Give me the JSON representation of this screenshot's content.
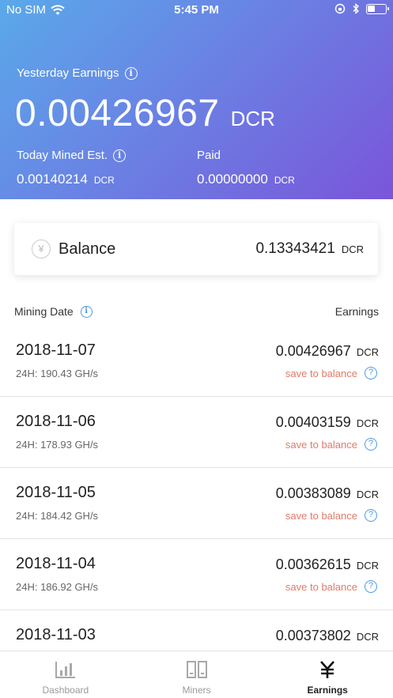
{
  "status": {
    "carrier": "No SIM",
    "time": "5:45 PM"
  },
  "hero": {
    "yesterday_label": "Yesterday Earnings",
    "yesterday_value": "0.00426967",
    "yesterday_unit": "DCR",
    "today_label": "Today Mined Est.",
    "today_value": "0.00140214",
    "today_unit": "DCR",
    "paid_label": "Paid",
    "paid_value": "0.00000000",
    "paid_unit": "DCR"
  },
  "balance": {
    "label": "Balance",
    "value": "0.13343421",
    "unit": "DCR"
  },
  "list": {
    "col_date": "Mining Date",
    "col_earnings": "Earnings",
    "rows": [
      {
        "date": "2018-11-07",
        "hashrate": "24H: 190.43 GH/s",
        "amount": "0.00426967",
        "unit": "DCR",
        "action": "save to balance"
      },
      {
        "date": "2018-11-06",
        "hashrate": "24H: 178.93 GH/s",
        "amount": "0.00403159",
        "unit": "DCR",
        "action": "save to balance"
      },
      {
        "date": "2018-11-05",
        "hashrate": "24H: 184.42 GH/s",
        "amount": "0.00383089",
        "unit": "DCR",
        "action": "save to balance"
      },
      {
        "date": "2018-11-04",
        "hashrate": "24H: 186.92 GH/s",
        "amount": "0.00362615",
        "unit": "DCR",
        "action": "save to balance"
      },
      {
        "date": "2018-11-03",
        "hashrate": "",
        "amount": "0.00373802",
        "unit": "DCR",
        "action": ""
      }
    ]
  },
  "tabs": [
    {
      "label": "Dashboard",
      "icon": "bar-chart-icon",
      "active": false
    },
    {
      "label": "Miners",
      "icon": "miners-icon",
      "active": false
    },
    {
      "label": "Earnings",
      "icon": "yen-icon",
      "active": true
    }
  ],
  "colors": {
    "accent_blue": "#4a9be6",
    "save_red": "#e07b6a",
    "hero_start": "#5aa9ea",
    "hero_end": "#7a55d9"
  }
}
